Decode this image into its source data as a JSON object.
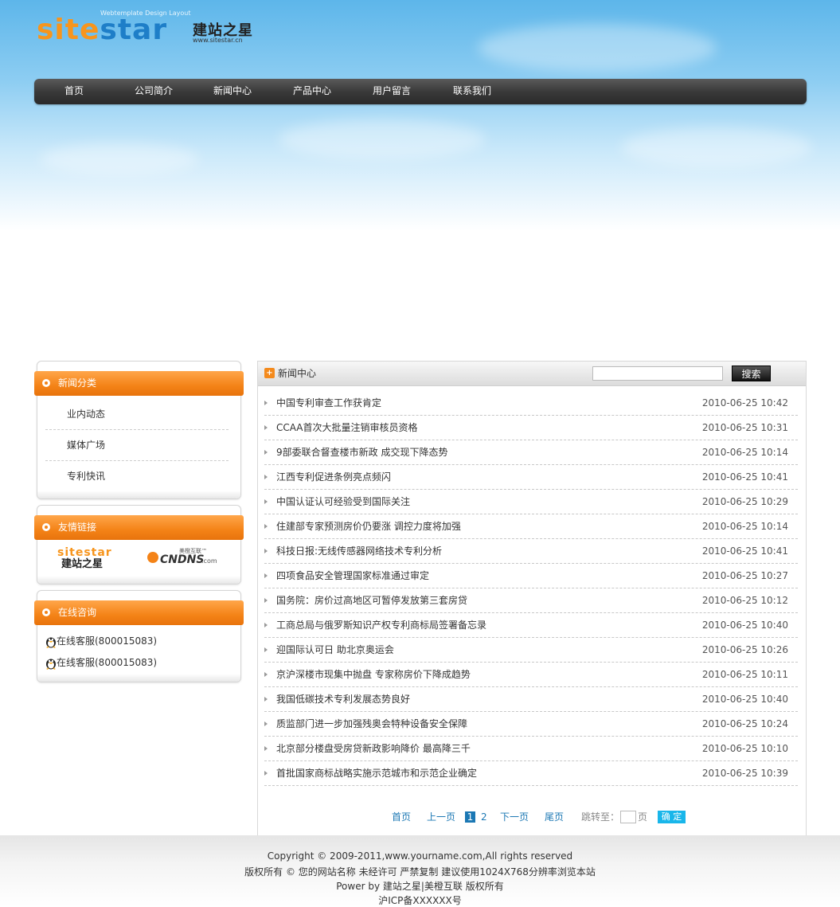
{
  "header": {
    "logo_brand_part1": "site",
    "logo_brand_part2": "star",
    "logo_cn": "建站之星",
    "logo_url": "www.sitestar.cn",
    "logo_tagline": "Webtemplate  Design  Layout"
  },
  "nav": [
    {
      "label": "首页"
    },
    {
      "label": "公司简介"
    },
    {
      "label": "新闻中心"
    },
    {
      "label": "产品中心"
    },
    {
      "label": "用户留言"
    },
    {
      "label": "联系我们"
    }
  ],
  "sidebar": {
    "category_title": "新闻分类",
    "categories": [
      "业内动态",
      "媒体广场",
      "专利快讯"
    ],
    "links_title": "友情链接",
    "link_logos": [
      {
        "top": "sitestar",
        "bottom": "建站之星"
      },
      {
        "main": "CNDNS",
        "sub": ".com",
        "badge": "美橙互联™"
      }
    ],
    "consult_title": "在线咨询",
    "consult_items": [
      "在线客服(800015083)",
      "在线客服(800015083)"
    ]
  },
  "main": {
    "title": "新闻中心",
    "search_button": "搜索",
    "news": [
      {
        "title": "中国专利审查工作获肯定",
        "date": "2010-06-25 10:42"
      },
      {
        "title": "CCAA首次大批量注销审核员资格",
        "date": "2010-06-25 10:31"
      },
      {
        "title": "9部委联合督查楼市新政 成交现下降态势",
        "date": "2010-06-25 10:14"
      },
      {
        "title": "江西专利促进条例亮点频闪",
        "date": "2010-06-25 10:41"
      },
      {
        "title": "中国认证认可经验受到国际关注",
        "date": "2010-06-25 10:29"
      },
      {
        "title": "住建部专家预测房价仍要涨 调控力度将加强",
        "date": "2010-06-25 10:14"
      },
      {
        "title": "科技日报:无线传感器网络技术专利分析",
        "date": "2010-06-25 10:41"
      },
      {
        "title": "四项食品安全管理国家标准通过审定",
        "date": "2010-06-25 10:27"
      },
      {
        "title": "国务院：房价过高地区可暂停发放第三套房贷",
        "date": "2010-06-25 10:12"
      },
      {
        "title": "工商总局与俄罗斯知识产权专利商标局签署备忘录",
        "date": "2010-06-25 10:40"
      },
      {
        "title": "迎国际认可日 助北京奥运会",
        "date": "2010-06-25 10:26"
      },
      {
        "title": "京沪深楼市现集中抛盘 专家称房价下降成趋势",
        "date": "2010-06-25 10:11"
      },
      {
        "title": "我国低碳技术专利发展态势良好",
        "date": "2010-06-25 10:40"
      },
      {
        "title": "质监部门进一步加强残奥会特种设备安全保障",
        "date": "2010-06-25 10:24"
      },
      {
        "title": "北京部分楼盘受房贷新政影响降价 最高降三千",
        "date": "2010-06-25 10:10"
      },
      {
        "title": "首批国家商标战略实施示范城市和示范企业确定",
        "date": "2010-06-25 10:39"
      }
    ],
    "pager": {
      "first": "首页",
      "prev": "上一页",
      "current": "1",
      "page2": "2",
      "next": "下一页",
      "last": "尾页",
      "goto_label": "跳转至：",
      "page_unit": "页",
      "ok": "确 定"
    }
  },
  "footer": {
    "line1": "Copyright © 2009-2011,www.yourname.com,All rights reserved",
    "line2": "版权所有 © 您的网站名称 未经许可 严禁复制 建议使用1024X768分辨率浏览本站",
    "line3": "Power by 建站之星|美橙互联 版权所有",
    "line4": "沪ICP备XXXXXX号"
  },
  "colors": {
    "accent_orange": "#f48317",
    "nav_dark": "#3a3a3a",
    "link_blue": "#1c78b4",
    "ok_button": "#19b6ea"
  }
}
